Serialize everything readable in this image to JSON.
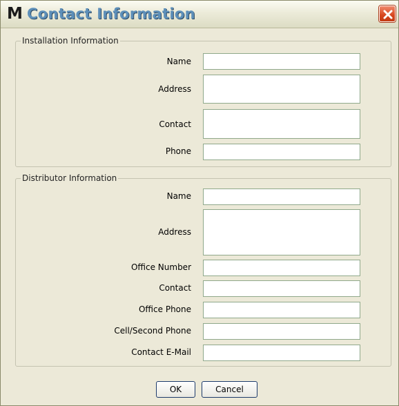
{
  "window": {
    "logo": "M",
    "title": "Contact Information",
    "close_label": "Close"
  },
  "installation": {
    "legend": "Installation Information",
    "fields": {
      "name": {
        "label": "Name",
        "value": ""
      },
      "address": {
        "label": "Address",
        "value": ""
      },
      "contact": {
        "label": "Contact",
        "value": ""
      },
      "phone": {
        "label": "Phone",
        "value": ""
      }
    }
  },
  "distributor": {
    "legend": "Distributor Information",
    "fields": {
      "name": {
        "label": "Name",
        "value": ""
      },
      "address": {
        "label": "Address",
        "value": ""
      },
      "office_number": {
        "label": "Office Number",
        "value": ""
      },
      "contact": {
        "label": "Contact",
        "value": ""
      },
      "office_phone": {
        "label": "Office Phone",
        "value": ""
      },
      "cell_phone": {
        "label": "Cell/Second Phone",
        "value": ""
      },
      "contact_email": {
        "label": "Contact E-Mail",
        "value": ""
      }
    }
  },
  "buttons": {
    "ok": "OK",
    "cancel": "Cancel"
  },
  "colors": {
    "title_text": "#5d8fb9",
    "close_button": "#d7471f",
    "window_bg": "#ece9d8"
  }
}
